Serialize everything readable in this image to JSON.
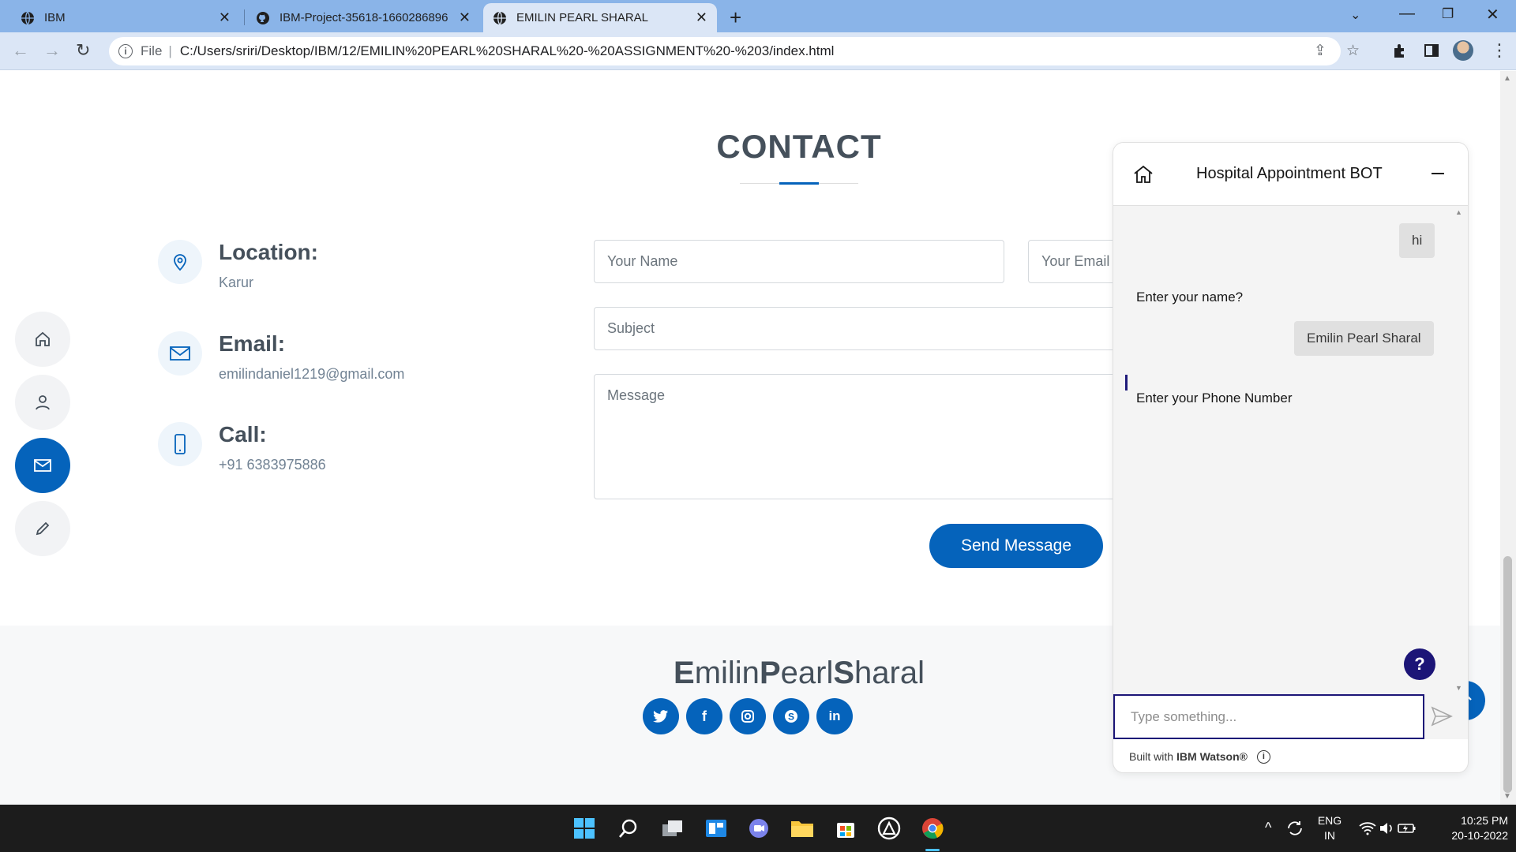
{
  "browser": {
    "tabs": [
      {
        "title": "IBM",
        "icon": "globe-icon"
      },
      {
        "title": "IBM-Project-35618-1660286896",
        "icon": "github-icon"
      },
      {
        "title": "EMILIN PEARL SHARAL",
        "icon": "globe-icon"
      }
    ],
    "address": {
      "file_label": "File",
      "url": "C:/Users/sriri/Desktop/IBM/12/EMILIN%20PEARL%20SHARAL%20-%20ASSIGNMENT%20-%203/index.html"
    }
  },
  "contact": {
    "title": "CONTACT",
    "location_label": "Location:",
    "location_value": "Karur",
    "email_label": "Email:",
    "email_value": "emilindaniel1219@gmail.com",
    "call_label": "Call:",
    "call_value": "+91 6383975886"
  },
  "form": {
    "name_placeholder": "Your Name",
    "email_placeholder": "Your Email",
    "subject_placeholder": "Subject",
    "message_placeholder": "Message",
    "send_label": "Send Message"
  },
  "side_nav": [
    "home-icon",
    "person-icon",
    "envelope-icon",
    "pencil-icon"
  ],
  "footer": {
    "name_parts": [
      "E",
      "milin",
      "P",
      "earl",
      "S",
      "haral"
    ],
    "socials": [
      "twitter-icon",
      "facebook-icon",
      "instagram-icon",
      "skype-icon",
      "linkedin-icon"
    ]
  },
  "chat": {
    "title": "Hospital Appointment BOT",
    "messages": [
      {
        "from": "user",
        "text": "hi"
      },
      {
        "from": "bot",
        "text": "Enter your name?"
      },
      {
        "from": "user",
        "text": "Emilin Pearl Sharal"
      },
      {
        "from": "bot",
        "text": "Enter your Phone Number"
      }
    ],
    "help_label": "?",
    "input_placeholder": "Type something...",
    "footer_prefix": "Built with",
    "footer_brand": "IBM Watson®"
  },
  "taskbar": {
    "lang_top": "ENG",
    "lang_bottom": "IN",
    "time": "10:25 PM",
    "date": "20-10-2022"
  },
  "colors": {
    "accent": "#0563bb",
    "chat_accent": "#1c1577",
    "tabbar": "#8ab4e8"
  }
}
